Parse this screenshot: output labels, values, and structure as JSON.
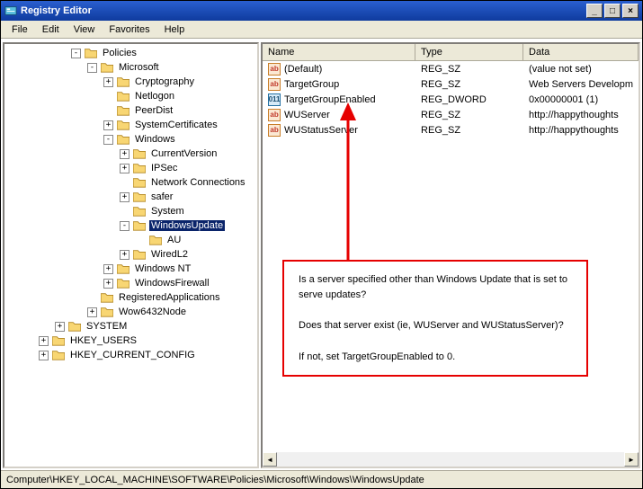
{
  "window": {
    "title": "Registry Editor"
  },
  "menu": {
    "file": "File",
    "edit": "Edit",
    "view": "View",
    "favorites": "Favorites",
    "help": "Help"
  },
  "tree": {
    "policies": "Policies",
    "microsoft": "Microsoft",
    "cryptography": "Cryptography",
    "netlogon": "Netlogon",
    "peerdist": "PeerDist",
    "systemcertificates": "SystemCertificates",
    "windows": "Windows",
    "currentversion": "CurrentVersion",
    "ipsec": "IPSec",
    "networkconnections": "Network Connections",
    "safer": "safer",
    "system": "System",
    "windowsupdate": "WindowsUpdate",
    "au": "AU",
    "wiredl2": "WiredL2",
    "windowsnt": "Windows NT",
    "windowsfirewall": "WindowsFirewall",
    "registeredapplications": "RegisteredApplications",
    "wow6432node": "Wow6432Node",
    "systemroot": "SYSTEM",
    "hkeyusers": "HKEY_USERS",
    "hkeycurrentconfig": "HKEY_CURRENT_CONFIG"
  },
  "columns": {
    "name": "Name",
    "type": "Type",
    "data": "Data"
  },
  "values": [
    {
      "icon": "str",
      "name": "(Default)",
      "type": "REG_SZ",
      "data": "(value not set)"
    },
    {
      "icon": "str",
      "name": "TargetGroup",
      "type": "REG_SZ",
      "data": "Web Servers Developm"
    },
    {
      "icon": "bin",
      "name": "TargetGroupEnabled",
      "type": "REG_DWORD",
      "data": "0x00000001 (1)"
    },
    {
      "icon": "str",
      "name": "WUServer",
      "type": "REG_SZ",
      "data": "http://happythoughts"
    },
    {
      "icon": "str",
      "name": "WUStatusServer",
      "type": "REG_SZ",
      "data": "http://happythoughts"
    }
  ],
  "callout": {
    "l1": "Is a server specified other than Windows Update that is set to serve updates?",
    "l2": "Does that server exist (ie, WUServer and WUStatusServer)?",
    "l3": "If not, set TargetGroupEnabled to 0."
  },
  "statusbar": {
    "path": "Computer\\HKEY_LOCAL_MACHINE\\SOFTWARE\\Policies\\Microsoft\\Windows\\WindowsUpdate"
  }
}
